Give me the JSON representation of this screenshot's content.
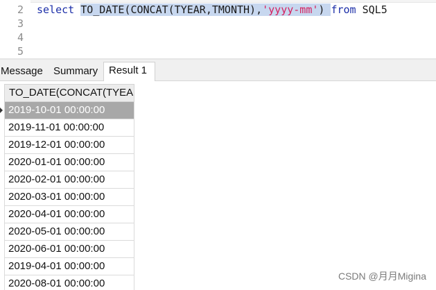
{
  "editor": {
    "lines": [
      {
        "num": "2",
        "kw_select": "select ",
        "selected_text": "TO_DATE(CONCAT(TYEAR,TMONTH),",
        "string_literal": "'yyyy-mm'",
        "close_paren": ")",
        "kw_from": "from",
        "table": " SQL5"
      },
      {
        "num": "3"
      },
      {
        "num": "4"
      },
      {
        "num": "5"
      }
    ]
  },
  "tabs": [
    {
      "label": "Message"
    },
    {
      "label": "Summary"
    },
    {
      "label": "Result 1"
    }
  ],
  "grid": {
    "column_header": "TO_DATE(CONCAT(TYEA",
    "rows": [
      "2019-10-01 00:00:00",
      "2019-11-01 00:00:00",
      "2019-12-01 00:00:00",
      "2020-01-01 00:00:00",
      "2020-02-01 00:00:00",
      "2020-03-01 00:00:00",
      "2020-04-01 00:00:00",
      "2020-05-01 00:00:00",
      "2020-06-01 00:00:00",
      "2019-04-01 00:00:00",
      "2020-08-01 00:00:00"
    ]
  },
  "watermark": "CSDN @月月Migina",
  "colors": {
    "keyword": "#1b2ea8",
    "string": "#d6205e",
    "selection": "#c7d7ef",
    "selected_row": "#a8a8a8"
  }
}
